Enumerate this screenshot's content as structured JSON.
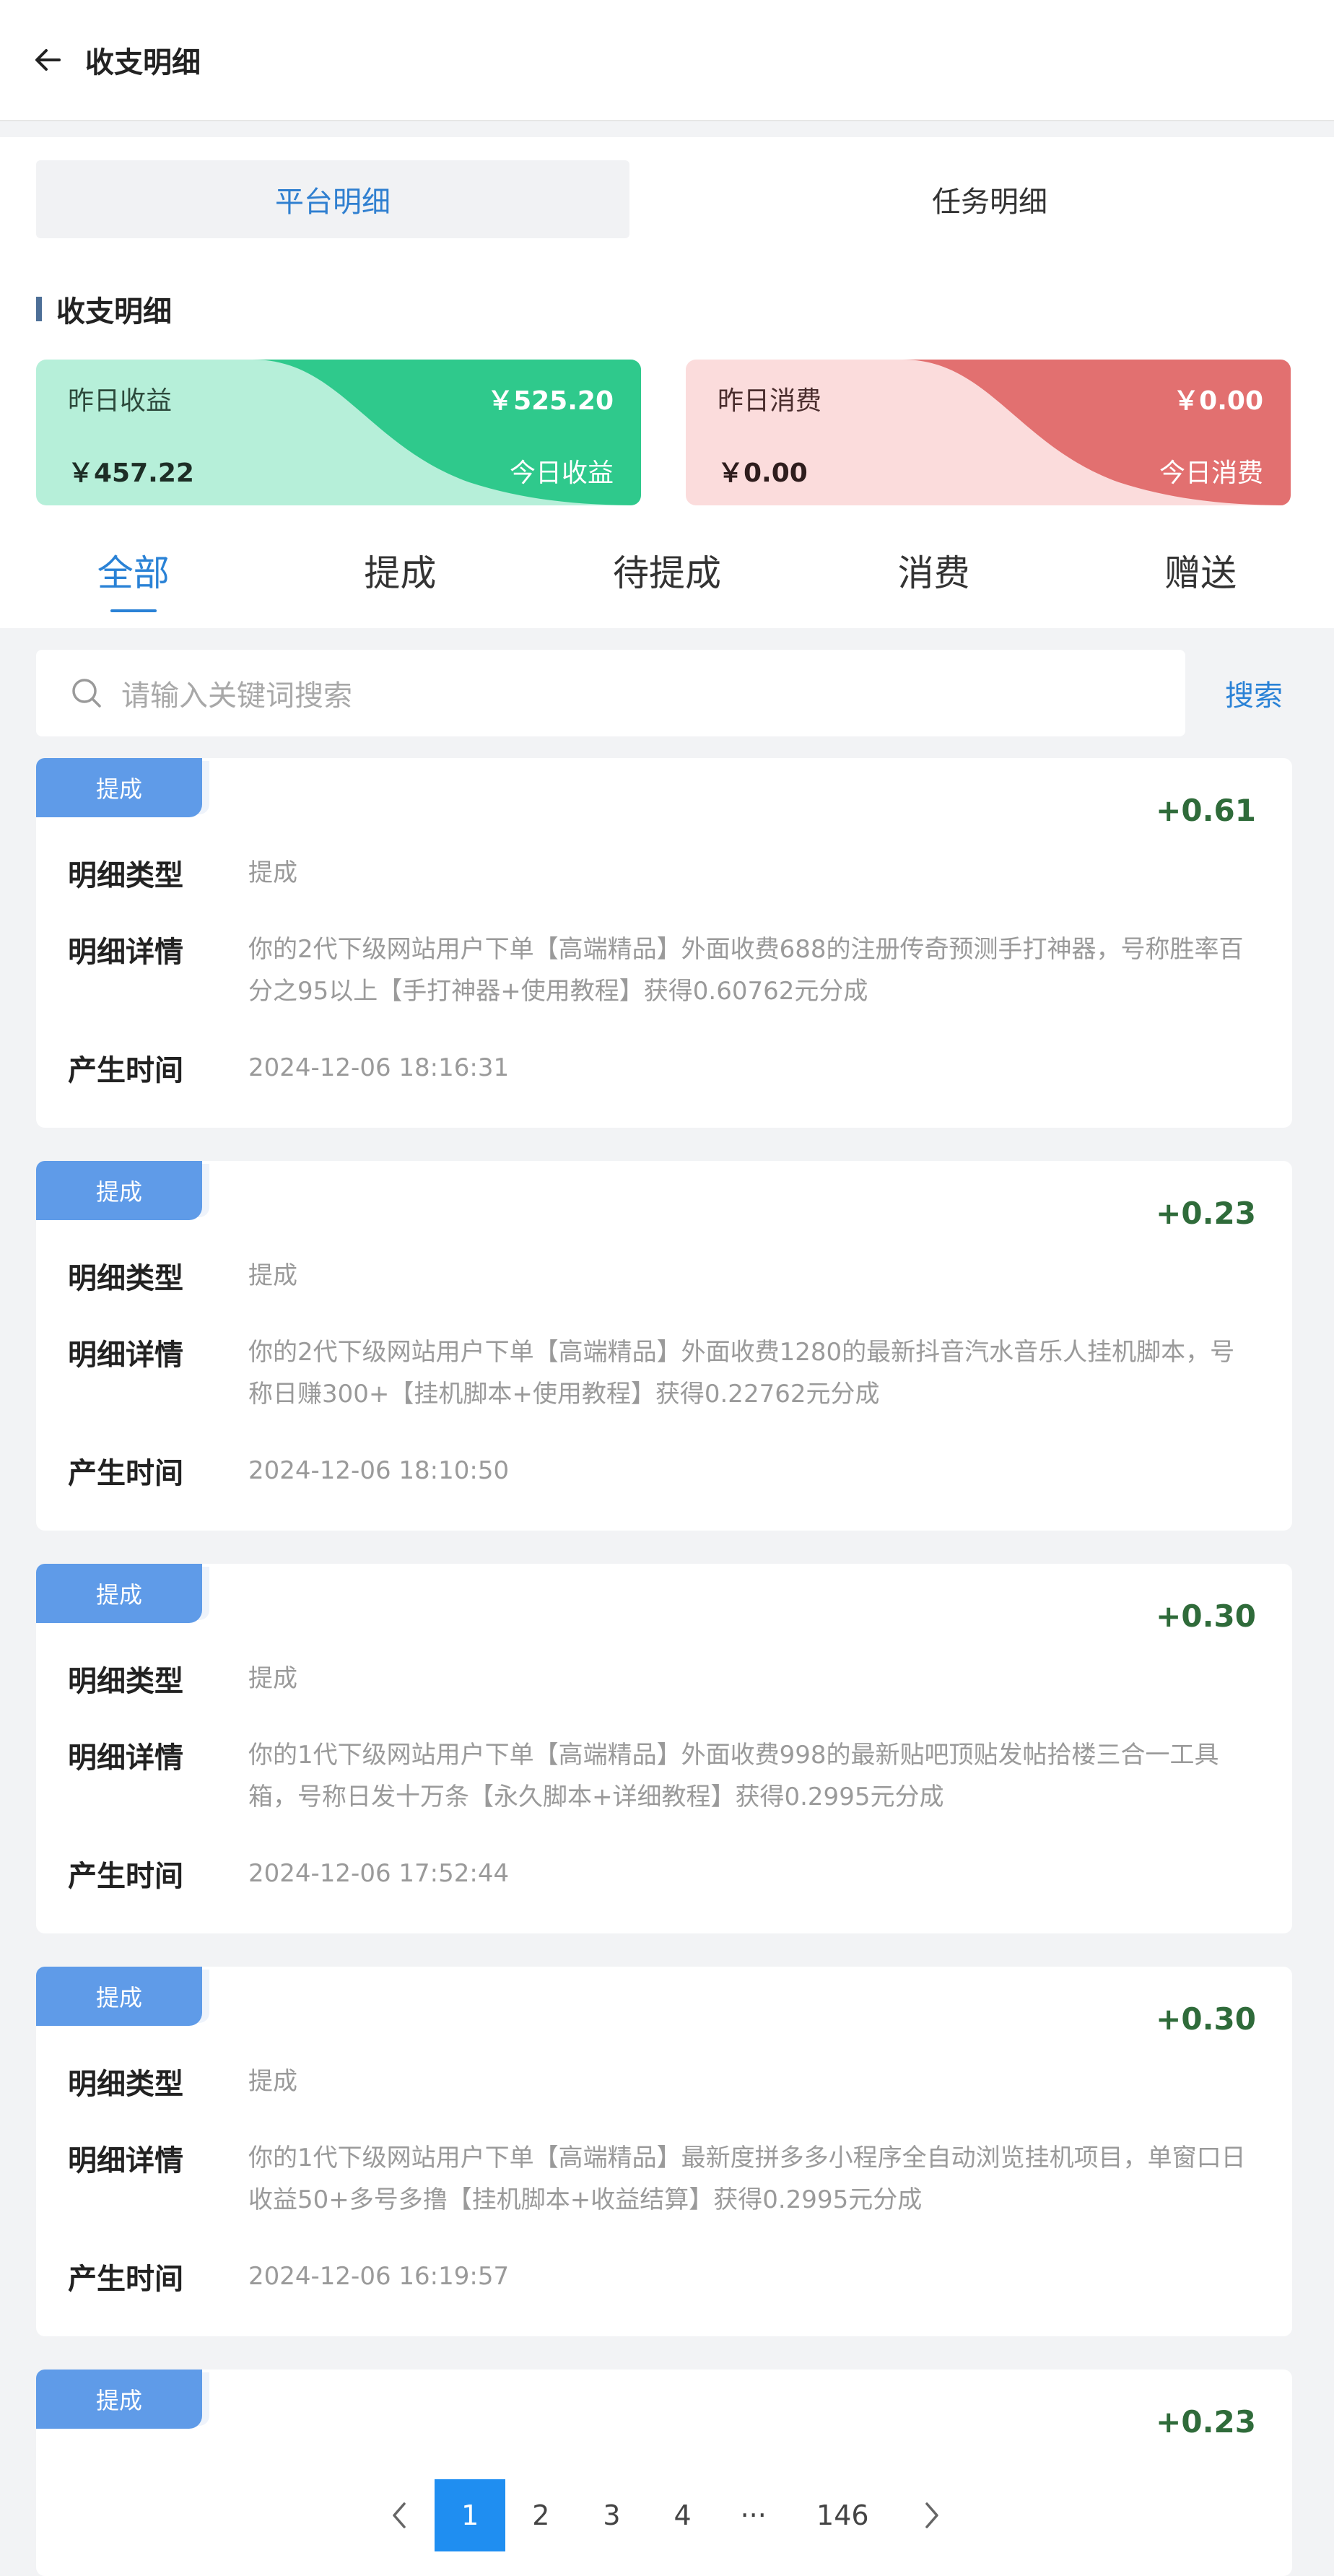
{
  "header": {
    "title": "收支明细",
    "back_icon": "arrow-left-icon"
  },
  "segments": [
    {
      "label": "平台明细",
      "active": true
    },
    {
      "label": "任务明细",
      "active": false
    }
  ],
  "section_title": "收支明细",
  "income_card": {
    "yesterday_label": "昨日收益",
    "yesterday_value": "￥525.20",
    "today_value": "￥457.22",
    "today_label": "今日收益",
    "colors": {
      "from": "#a8ecd0",
      "to": "#2ecb8c"
    }
  },
  "expense_card": {
    "yesterday_label": "昨日消费",
    "yesterday_value": "￥0.00",
    "today_value": "￥0.00",
    "today_label": "今日消费",
    "colors": {
      "from": "#fbe0e0",
      "to": "#e36f6f"
    }
  },
  "tabs": [
    {
      "label": "全部",
      "active": true
    },
    {
      "label": "提成",
      "active": false
    },
    {
      "label": "待提成",
      "active": false
    },
    {
      "label": "消费",
      "active": false
    },
    {
      "label": "赠送",
      "active": false
    }
  ],
  "search": {
    "placeholder": "请输入关键词搜索",
    "button_label": "搜索"
  },
  "field_labels": {
    "type": "明细类型",
    "detail": "明细详情",
    "time": "产生时间"
  },
  "records": [
    {
      "badge": "提成",
      "amount": "+0.61",
      "type": "提成",
      "detail": "你的2代下级网站用户下单【高端精品】外面收费688的注册传奇预测手打神器，号称胜率百分之95以上【手打神器+使用教程】获得0.60762元分成",
      "time": "2024-12-06 18:16:31"
    },
    {
      "badge": "提成",
      "amount": "+0.23",
      "type": "提成",
      "detail": "你的2代下级网站用户下单【高端精品】外面收费1280的最新抖音汽水音乐人挂机脚本，号称日赚300+【挂机脚本+使用教程】获得0.22762元分成",
      "time": "2024-12-06 18:10:50"
    },
    {
      "badge": "提成",
      "amount": "+0.30",
      "type": "提成",
      "detail": "你的1代下级网站用户下单【高端精品】外面收费998的最新贴吧顶贴发帖拾楼三合一工具箱，号称日发十万条【永久脚本+详细教程】获得0.2995元分成",
      "time": "2024-12-06 17:52:44"
    },
    {
      "badge": "提成",
      "amount": "+0.30",
      "type": "提成",
      "detail": "你的1代下级网站用户下单【高端精品】最新度拼多多小程序全自动浏览挂机项目，单窗口日收益50+多号多撸【挂机脚本+收益结算】获得0.2995元分成",
      "time": "2024-12-06 16:19:57"
    },
    {
      "badge": "提成",
      "amount": "+0.23"
    }
  ],
  "pagination": {
    "prev_icon": "chevron-left-icon",
    "next_icon": "chevron-right-icon",
    "pages": [
      "1",
      "2",
      "3",
      "4",
      "···",
      "146"
    ],
    "current": "1"
  }
}
